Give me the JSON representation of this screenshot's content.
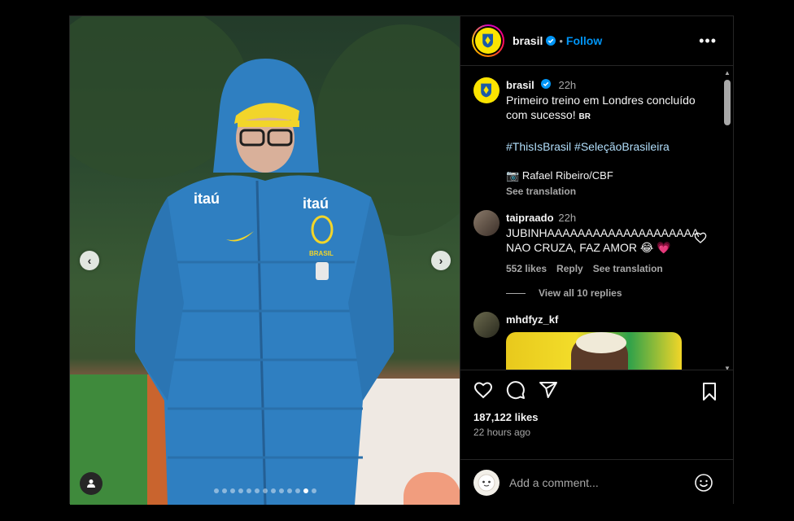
{
  "post": {
    "username": "brasil",
    "follow_label": "Follow",
    "separator": "•",
    "more_label": "•••",
    "carousel": {
      "total": 13,
      "active_index": 11
    }
  },
  "caption": {
    "username": "brasil",
    "time": "22h",
    "text": "Primeiro treino em Londres concluído com sucesso!",
    "flag": "BR",
    "hashtag1": "#ThisIsBrasil",
    "hashtag2": "#SeleçãoBrasileira",
    "credit_icon": "📷",
    "credit": "Rafael Ribeiro/CBF",
    "see_translation": "See translation"
  },
  "comments": [
    {
      "username": "taipraado",
      "time": "22h",
      "text": "JUBINHAAAAAAAAAAAAAAAAAAAA NAO CRUZA, FAZ AMOR 😂 💗",
      "likes": "552 likes",
      "reply": "Reply",
      "see_translation": "See translation",
      "view_replies": "View all 10 replies"
    },
    {
      "username": "mhdfyz_kf"
    }
  ],
  "actions": {
    "likes": "187,122 likes",
    "time_ago": "22 hours ago"
  },
  "composer": {
    "placeholder": "Add a comment..."
  },
  "colors": {
    "accent": "#0095f6",
    "hashtag": "#b2dffc",
    "crest_yellow": "#fbe400",
    "coat_blue": "#2f7fc1"
  },
  "icons": [
    "verified-badge-icon",
    "more-icon",
    "heart-icon",
    "comment-icon",
    "share-icon",
    "bookmark-icon",
    "emoji-icon",
    "user-tag-icon",
    "chevron-left-icon",
    "chevron-right-icon"
  ]
}
